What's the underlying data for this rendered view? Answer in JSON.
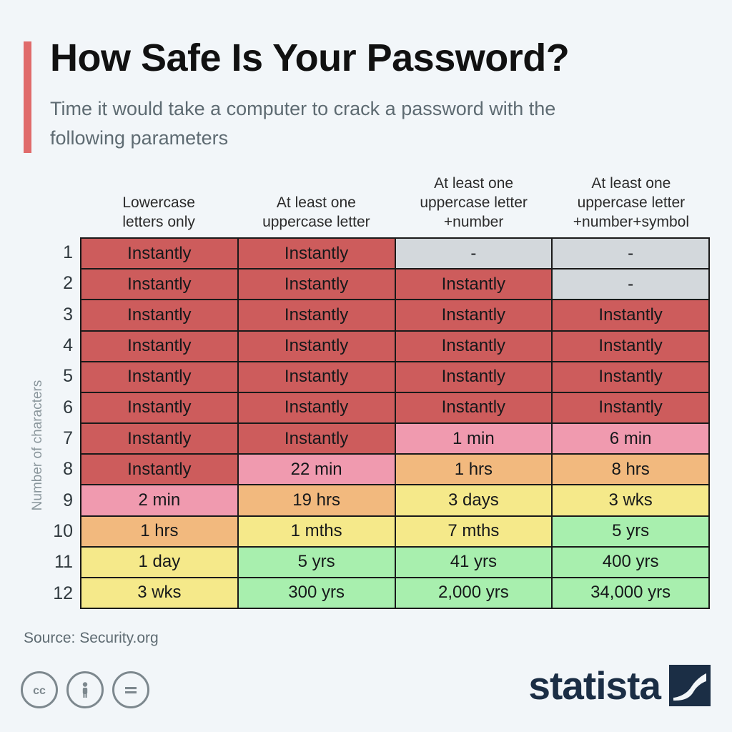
{
  "header": {
    "title": "How Safe Is Your Password?",
    "subtitle": "Time it would take a computer to crack a password with the following parameters",
    "accent_color": "#E06B6B"
  },
  "footer": {
    "source": "Source: Security.org",
    "license_icons": [
      "cc-icon",
      "cc-by-person-icon",
      "cc-equals-icon"
    ],
    "brand": "statista",
    "brand_color": "#1B2E45"
  },
  "chart_data": {
    "type": "heatmap",
    "title": "How Safe Is Your Password?",
    "subtitle": "Time it would take a computer to crack a password with the following parameters",
    "ylabel": "Number of characters",
    "xlabel": "",
    "categories": [
      "Lowercase\nletters only",
      "At least one\nuppercase letter",
      "At least one\nuppercase letter\n+number",
      "At least one\nuppercase letter\n+number+symbol"
    ],
    "column_headers": [
      [
        "Lowercase",
        "letters only"
      ],
      [
        "At least one",
        "uppercase letter"
      ],
      [
        "At least one",
        "uppercase letter",
        "+number"
      ],
      [
        "At least one",
        "uppercase letter",
        "+number+symbol"
      ]
    ],
    "row_labels": [
      "1",
      "2",
      "3",
      "4",
      "5",
      "6",
      "7",
      "8",
      "9",
      "10",
      "11",
      "12"
    ],
    "color_scale": {
      "red": "#CD5C5C",
      "pink": "#F09AAF",
      "orange": "#F2B97E",
      "yellow": "#F5E98A",
      "green": "#A8EFAE",
      "gray": "#D3D8DC"
    },
    "rows": [
      {
        "label": "1",
        "cells": [
          {
            "value": "Instantly",
            "color": "#CD5C5C"
          },
          {
            "value": "Instantly",
            "color": "#CD5C5C"
          },
          {
            "value": "-",
            "color": "#D3D8DC"
          },
          {
            "value": "-",
            "color": "#D3D8DC"
          }
        ]
      },
      {
        "label": "2",
        "cells": [
          {
            "value": "Instantly",
            "color": "#CD5C5C"
          },
          {
            "value": "Instantly",
            "color": "#CD5C5C"
          },
          {
            "value": "Instantly",
            "color": "#CD5C5C"
          },
          {
            "value": "-",
            "color": "#D3D8DC"
          }
        ]
      },
      {
        "label": "3",
        "cells": [
          {
            "value": "Instantly",
            "color": "#CD5C5C"
          },
          {
            "value": "Instantly",
            "color": "#CD5C5C"
          },
          {
            "value": "Instantly",
            "color": "#CD5C5C"
          },
          {
            "value": "Instantly",
            "color": "#CD5C5C"
          }
        ]
      },
      {
        "label": "4",
        "cells": [
          {
            "value": "Instantly",
            "color": "#CD5C5C"
          },
          {
            "value": "Instantly",
            "color": "#CD5C5C"
          },
          {
            "value": "Instantly",
            "color": "#CD5C5C"
          },
          {
            "value": "Instantly",
            "color": "#CD5C5C"
          }
        ]
      },
      {
        "label": "5",
        "cells": [
          {
            "value": "Instantly",
            "color": "#CD5C5C"
          },
          {
            "value": "Instantly",
            "color": "#CD5C5C"
          },
          {
            "value": "Instantly",
            "color": "#CD5C5C"
          },
          {
            "value": "Instantly",
            "color": "#CD5C5C"
          }
        ]
      },
      {
        "label": "6",
        "cells": [
          {
            "value": "Instantly",
            "color": "#CD5C5C"
          },
          {
            "value": "Instantly",
            "color": "#CD5C5C"
          },
          {
            "value": "Instantly",
            "color": "#CD5C5C"
          },
          {
            "value": "Instantly",
            "color": "#CD5C5C"
          }
        ]
      },
      {
        "label": "7",
        "cells": [
          {
            "value": "Instantly",
            "color": "#CD5C5C"
          },
          {
            "value": "Instantly",
            "color": "#CD5C5C"
          },
          {
            "value": "1 min",
            "color": "#F09AAF"
          },
          {
            "value": "6 min",
            "color": "#F09AAF"
          }
        ]
      },
      {
        "label": "8",
        "cells": [
          {
            "value": "Instantly",
            "color": "#CD5C5C"
          },
          {
            "value": "22 min",
            "color": "#F09AAF"
          },
          {
            "value": "1 hrs",
            "color": "#F2B97E"
          },
          {
            "value": "8 hrs",
            "color": "#F2B97E"
          }
        ]
      },
      {
        "label": "9",
        "cells": [
          {
            "value": "2 min",
            "color": "#F09AAF"
          },
          {
            "value": "19 hrs",
            "color": "#F2B97E"
          },
          {
            "value": "3 days",
            "color": "#F5E98A"
          },
          {
            "value": "3 wks",
            "color": "#F5E98A"
          }
        ]
      },
      {
        "label": "10",
        "cells": [
          {
            "value": "1 hrs",
            "color": "#F2B97E"
          },
          {
            "value": "1 mths",
            "color": "#F5E98A"
          },
          {
            "value": "7 mths",
            "color": "#F5E98A"
          },
          {
            "value": "5 yrs",
            "color": "#A8EFAE"
          }
        ]
      },
      {
        "label": "11",
        "cells": [
          {
            "value": "1 day",
            "color": "#F5E98A"
          },
          {
            "value": "5 yrs",
            "color": "#A8EFAE"
          },
          {
            "value": "41 yrs",
            "color": "#A8EFAE"
          },
          {
            "value": "400 yrs",
            "color": "#A8EFAE"
          }
        ]
      },
      {
        "label": "12",
        "cells": [
          {
            "value": "3 wks",
            "color": "#F5E98A"
          },
          {
            "value": "300 yrs",
            "color": "#A8EFAE"
          },
          {
            "value": "2,000 yrs",
            "color": "#A8EFAE"
          },
          {
            "value": "34,000 yrs",
            "color": "#A8EFAE"
          }
        ]
      }
    ]
  }
}
